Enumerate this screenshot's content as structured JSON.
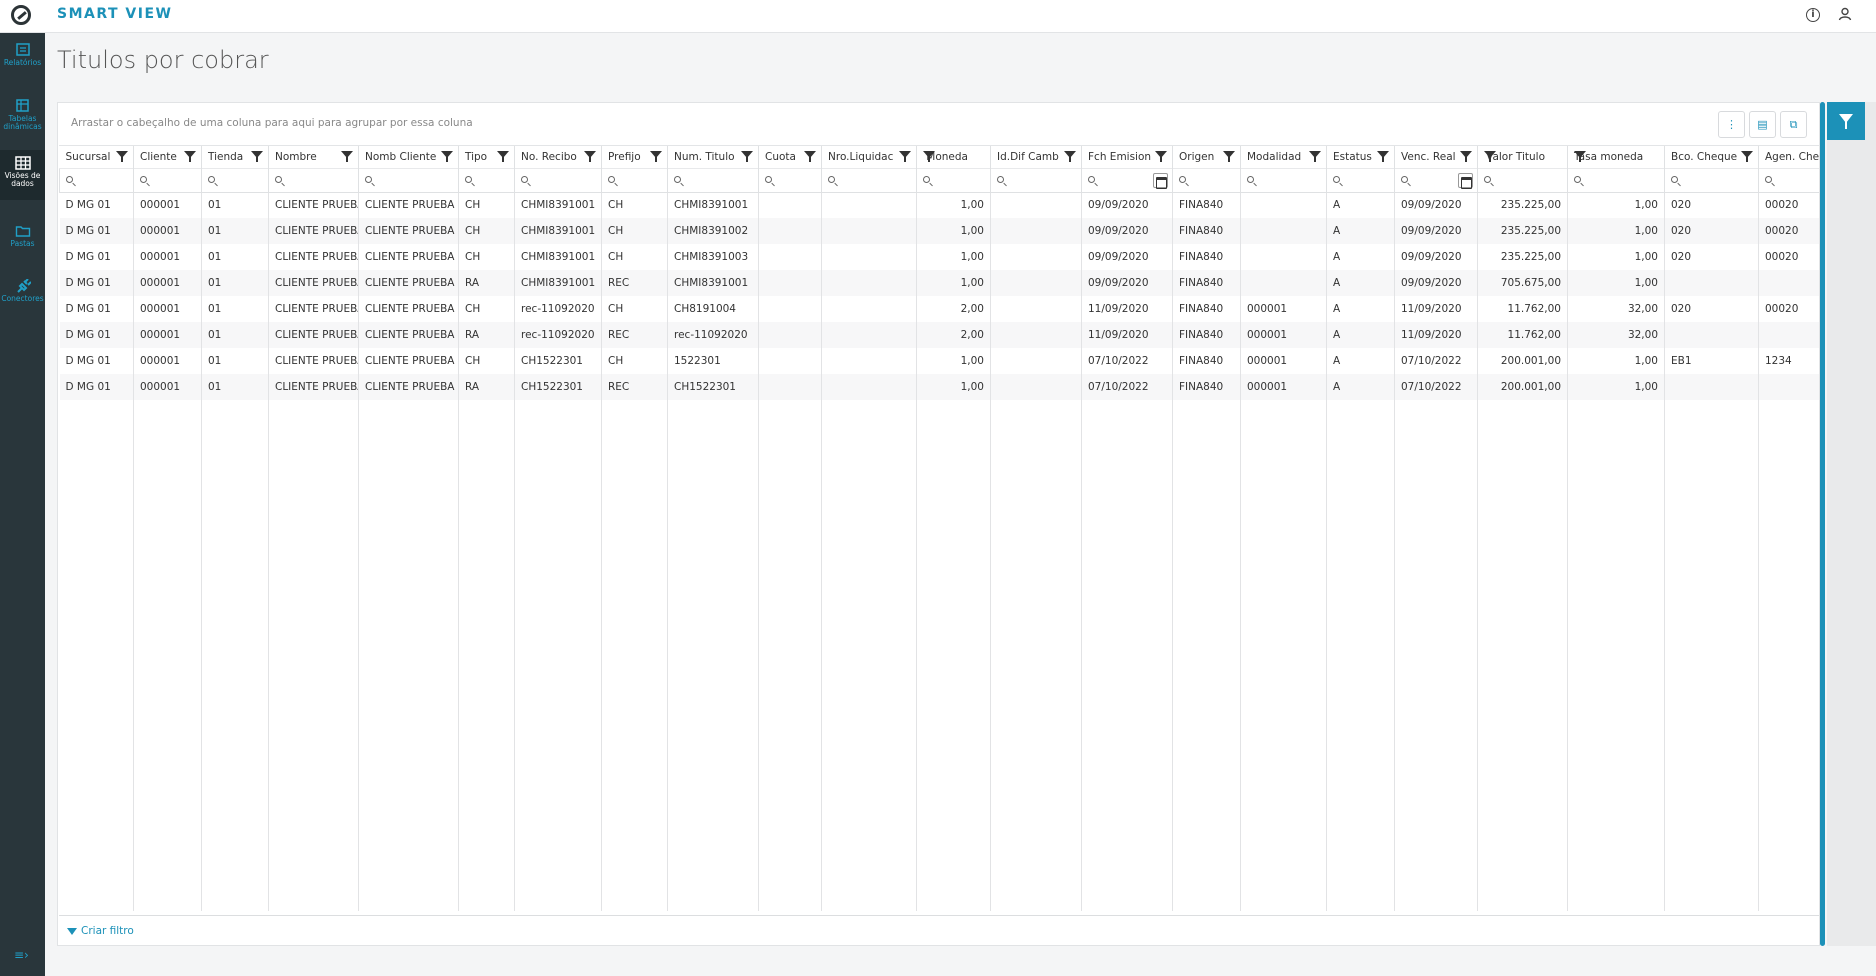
{
  "header": {
    "title": "SMART VIEW"
  },
  "sidebar": {
    "items": [
      {
        "label": "Relatórios",
        "icon": "report-icon"
      },
      {
        "label": "Tabelas dinâmicas",
        "icon": "pivot-table-icon"
      },
      {
        "label": "Visões de dados",
        "icon": "grid-icon",
        "active": true
      },
      {
        "label": "Pastas",
        "icon": "folder-icon"
      },
      {
        "label": "Conectores",
        "icon": "plug-icon"
      }
    ]
  },
  "page": {
    "title": "Titulos por cobrar"
  },
  "grid": {
    "group_hint": "Arrastar o cabeçalho de uma coluna para aqui para agrupar por essa coluna",
    "columns": [
      {
        "label": "Sucursal",
        "align": "left"
      },
      {
        "label": "Cliente",
        "align": "left"
      },
      {
        "label": "Tienda",
        "align": "left"
      },
      {
        "label": "Nombre",
        "align": "left"
      },
      {
        "label": "Nomb Cliente",
        "align": "left"
      },
      {
        "label": "Tipo",
        "align": "left"
      },
      {
        "label": "No. Recibo",
        "align": "left"
      },
      {
        "label": "Prefijo",
        "align": "left"
      },
      {
        "label": "Num. Titulo",
        "align": "left"
      },
      {
        "label": "Cuota",
        "align": "left"
      },
      {
        "label": "Nro.Liquidac",
        "align": "left"
      },
      {
        "label": "Moneda",
        "align": "right"
      },
      {
        "label": "Id.Dif Camb",
        "align": "left"
      },
      {
        "label": "Fch Emision",
        "align": "left",
        "date": true
      },
      {
        "label": "Origen",
        "align": "left"
      },
      {
        "label": "Modalidad",
        "align": "left"
      },
      {
        "label": "Estatus",
        "align": "left"
      },
      {
        "label": "Venc. Real",
        "align": "left",
        "date": true
      },
      {
        "label": "Valor Titulo",
        "align": "right"
      },
      {
        "label": "Tasa moneda",
        "align": "right"
      },
      {
        "label": "Bco. Cheque",
        "align": "left"
      },
      {
        "label": "Agen. Cheque",
        "align": "left"
      }
    ],
    "rows": [
      [
        "D MG 01",
        "000001",
        "01",
        "CLIENTE PRUEBA",
        "CLIENTE PRUEBA",
        "CH",
        "CHMI8391001",
        "CH",
        "CHMI8391001",
        "",
        "",
        "1,00",
        "",
        "09/09/2020",
        "FINA840",
        "",
        "A",
        "09/09/2020",
        "235.225,00",
        "1,00",
        "020",
        "00020"
      ],
      [
        "D MG 01",
        "000001",
        "01",
        "CLIENTE PRUEBA",
        "CLIENTE PRUEBA",
        "CH",
        "CHMI8391001",
        "CH",
        "CHMI8391002",
        "",
        "",
        "1,00",
        "",
        "09/09/2020",
        "FINA840",
        "",
        "A",
        "09/09/2020",
        "235.225,00",
        "1,00",
        "020",
        "00020"
      ],
      [
        "D MG 01",
        "000001",
        "01",
        "CLIENTE PRUEBA",
        "CLIENTE PRUEBA",
        "CH",
        "CHMI8391001",
        "CH",
        "CHMI8391003",
        "",
        "",
        "1,00",
        "",
        "09/09/2020",
        "FINA840",
        "",
        "A",
        "09/09/2020",
        "235.225,00",
        "1,00",
        "020",
        "00020"
      ],
      [
        "D MG 01",
        "000001",
        "01",
        "CLIENTE PRUEBA",
        "CLIENTE PRUEBA",
        "RA",
        "CHMI8391001",
        "REC",
        "CHMI8391001",
        "",
        "",
        "1,00",
        "",
        "09/09/2020",
        "FINA840",
        "",
        "A",
        "09/09/2020",
        "705.675,00",
        "1,00",
        "",
        ""
      ],
      [
        "D MG 01",
        "000001",
        "01",
        "CLIENTE PRUEBA",
        "CLIENTE PRUEBA",
        "CH",
        "rec-11092020",
        "CH",
        "CH8191004",
        "",
        "",
        "2,00",
        "",
        "11/09/2020",
        "FINA840",
        "000001",
        "A",
        "11/09/2020",
        "11.762,00",
        "32,00",
        "020",
        "00020"
      ],
      [
        "D MG 01",
        "000001",
        "01",
        "CLIENTE PRUEBA",
        "CLIENTE PRUEBA",
        "RA",
        "rec-11092020",
        "REC",
        "rec-11092020",
        "",
        "",
        "2,00",
        "",
        "11/09/2020",
        "FINA840",
        "000001",
        "A",
        "11/09/2020",
        "11.762,00",
        "32,00",
        "",
        ""
      ],
      [
        "D MG 01",
        "000001",
        "01",
        "CLIENTE PRUEBA",
        "CLIENTE PRUEBA",
        "CH",
        "CH1522301",
        "CH",
        "1522301",
        "",
        "",
        "1,00",
        "",
        "07/10/2022",
        "FINA840",
        "000001",
        "A",
        "07/10/2022",
        "200.001,00",
        "1,00",
        "EB1",
        "1234"
      ],
      [
        "D MG 01",
        "000001",
        "01",
        "CLIENTE PRUEBA",
        "CLIENTE PRUEBA",
        "RA",
        "CH1522301",
        "REC",
        "CH1522301",
        "",
        "",
        "1,00",
        "",
        "07/10/2022",
        "FINA840",
        "000001",
        "A",
        "07/10/2022",
        "200.001,00",
        "1,00",
        "",
        ""
      ]
    ],
    "footer": {
      "create_filter": "Criar filtro"
    }
  },
  "colors": {
    "accent": "#1c91b8",
    "sidebar_bg": "#29363b"
  }
}
